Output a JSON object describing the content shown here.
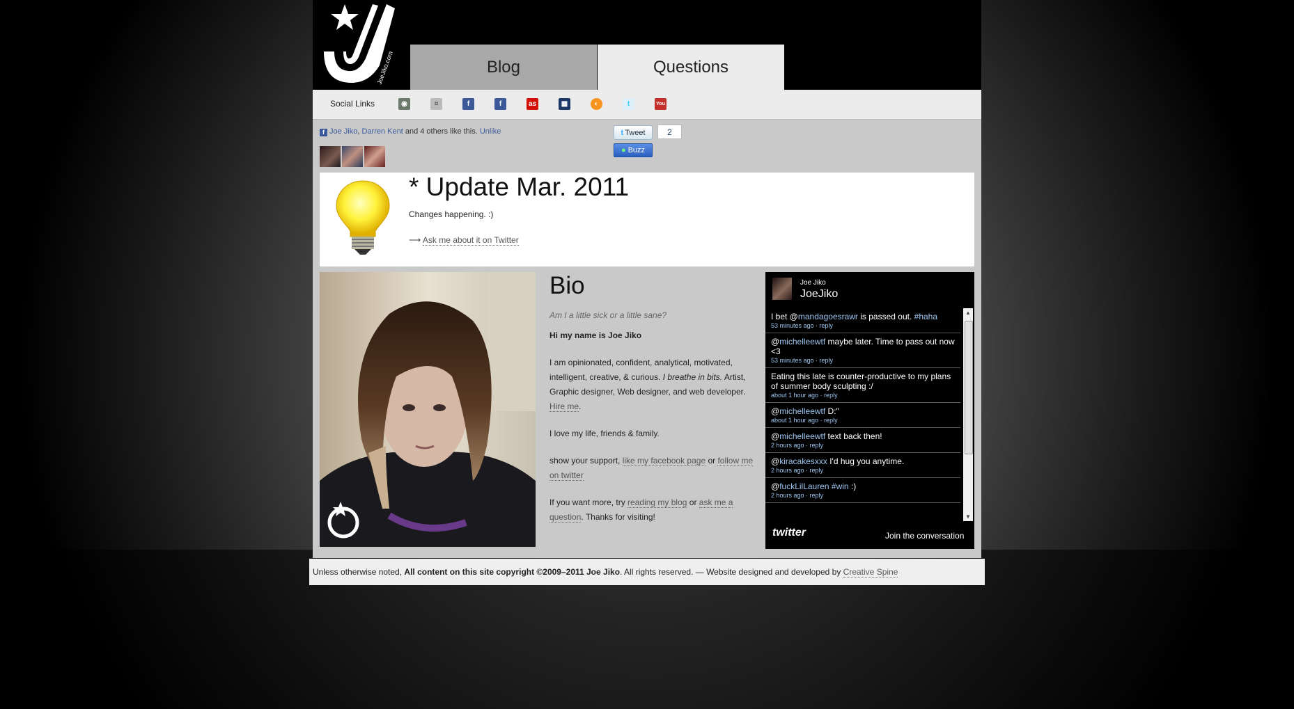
{
  "nav": {
    "blog": "Blog",
    "questions": "Questions"
  },
  "social": {
    "label": "Social Links",
    "icons": [
      "deviantart-icon",
      "formspring-icon",
      "facebook-icon",
      "facebook-page-icon",
      "lastfm-icon",
      "myspace-icon",
      "rss-icon",
      "twitter-icon",
      "youtube-icon"
    ]
  },
  "facebook_like": {
    "name1": "Joe Jiko",
    "sep": ", ",
    "name2": "Darren Kent",
    "rest": " and 4 others like this. ",
    "unlike": "Unlike"
  },
  "share": {
    "tweet": "Tweet",
    "tweet_count": "2",
    "buzz": "Buzz"
  },
  "update": {
    "title": "* Update Mar. 2011",
    "text": "Changes happening. :)",
    "arrow": "⟶ ",
    "ask_link": "Ask me about it on Twitter"
  },
  "bio": {
    "heading": "Bio",
    "tagline": "Am I a little sick or a little sane?",
    "hi": "Hi my name is Joe Jiko",
    "p1_a": "I am opinionated, confident, analytical, motivated, intelligent, creative, & curious. ",
    "p1_em": "I breathe in bits.",
    "p1_b": " Artist, Graphic designer, Web designer, and web developer. ",
    "hire": "Hire me",
    "p1_end": ".",
    "p2": "I love my life, friends & family.",
    "p3_a": "show your support, ",
    "p3_fb": "like my facebook page",
    "p3_or": " or ",
    "p3_tw": "follow me on twitter",
    "p4_a": "If you want more, try ",
    "p4_blog": "reading my blog",
    "p4_or": " or ",
    "p4_ask": "ask me a question",
    "p4_end": ". Thanks for visiting!"
  },
  "twitter": {
    "name": "Joe Jiko",
    "handle": "JoeJiko",
    "tweets": [
      {
        "pre": "I bet @",
        "mention": "mandagoesrawr",
        "post": " is passed out. ",
        "tag": "#haha",
        "time": "53 minutes ago",
        "reply": "reply"
      },
      {
        "pre": "@",
        "mention": "michelleewtf",
        "post": " maybe later. Time to pass out now <3",
        "tag": "",
        "time": "53 minutes ago",
        "reply": "reply"
      },
      {
        "pre": "",
        "mention": "",
        "post": "Eating this late is counter-productive to my plans of summer body sculpting :/",
        "tag": "",
        "time": "about 1 hour ago",
        "reply": "reply"
      },
      {
        "pre": "@",
        "mention": "michelleewtf",
        "post": " D:\"",
        "tag": "",
        "time": "about 1 hour ago",
        "reply": "reply"
      },
      {
        "pre": "@",
        "mention": "michelleewtf",
        "post": " text back then!",
        "tag": "",
        "time": "2 hours ago",
        "reply": "reply"
      },
      {
        "pre": "@",
        "mention": "kiracakesxxx",
        "post": " I'd hug you anytime.",
        "tag": "",
        "time": "2 hours ago",
        "reply": "reply"
      },
      {
        "pre": "@",
        "mention": "fuckLilLauren",
        "post": " ",
        "tag": "#win",
        "post2": " :)",
        "time": "2 hours ago",
        "reply": "reply"
      }
    ],
    "footer_logo": "twitter",
    "join": "Join the conversation"
  },
  "footer": {
    "a": "Unless otherwise noted, ",
    "b": "All content on this site copyright ©2009–2011 Joe Jiko",
    "c": ". All rights reserved. — Website designed and developed by ",
    "link": "Creative Spine"
  }
}
